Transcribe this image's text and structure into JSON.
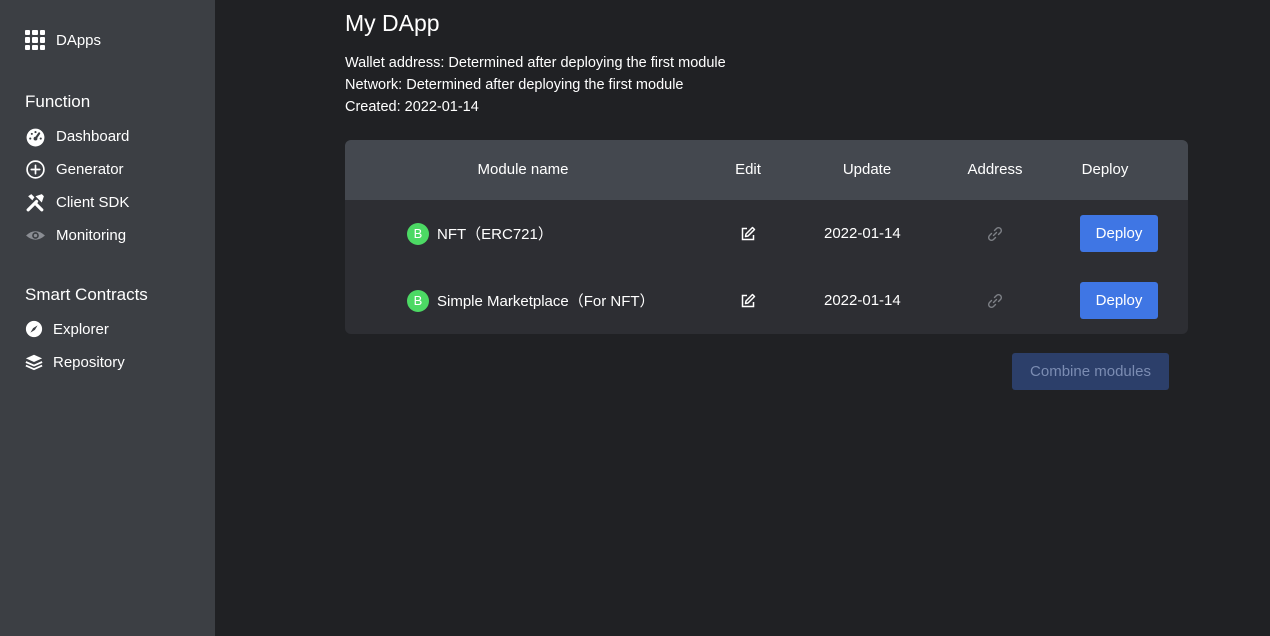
{
  "sidebar": {
    "top_label": "DApps",
    "sections": [
      {
        "title": "Function",
        "items": [
          {
            "label": "Dashboard",
            "icon": "gauge-icon"
          },
          {
            "label": "Generator",
            "icon": "plus-circle-icon"
          },
          {
            "label": "Client SDK",
            "icon": "tools-icon"
          },
          {
            "label": "Monitoring",
            "icon": "eye-icon"
          }
        ]
      },
      {
        "title": "Smart Contracts",
        "items": [
          {
            "label": "Explorer",
            "icon": "compass-icon"
          },
          {
            "label": "Repository",
            "icon": "layers-icon"
          }
        ]
      }
    ]
  },
  "main": {
    "title": "My DApp",
    "wallet_address": "Wallet address: Determined after deploying the first module",
    "network": "Network: Determined after deploying the first module",
    "created": "Created: 2022-01-14",
    "table": {
      "headers": {
        "module_name": "Module name",
        "edit": "Edit",
        "update": "Update",
        "address": "Address",
        "deploy": "Deploy"
      },
      "rows": [
        {
          "badge": "B",
          "name": "NFT（ERC721）",
          "update": "2022-01-14",
          "deploy_label": "Deploy"
        },
        {
          "badge": "B",
          "name": "Simple Marketplace（For NFT）",
          "update": "2022-01-14",
          "deploy_label": "Deploy"
        }
      ]
    },
    "combine_label": "Combine modules"
  },
  "colors": {
    "sidebar_bg": "#3c3f44",
    "main_bg": "#202124",
    "table_header_bg": "#44484f",
    "table_body_bg": "#2d2e33",
    "accent": "#3f76e4",
    "badge": "#4cd964"
  }
}
